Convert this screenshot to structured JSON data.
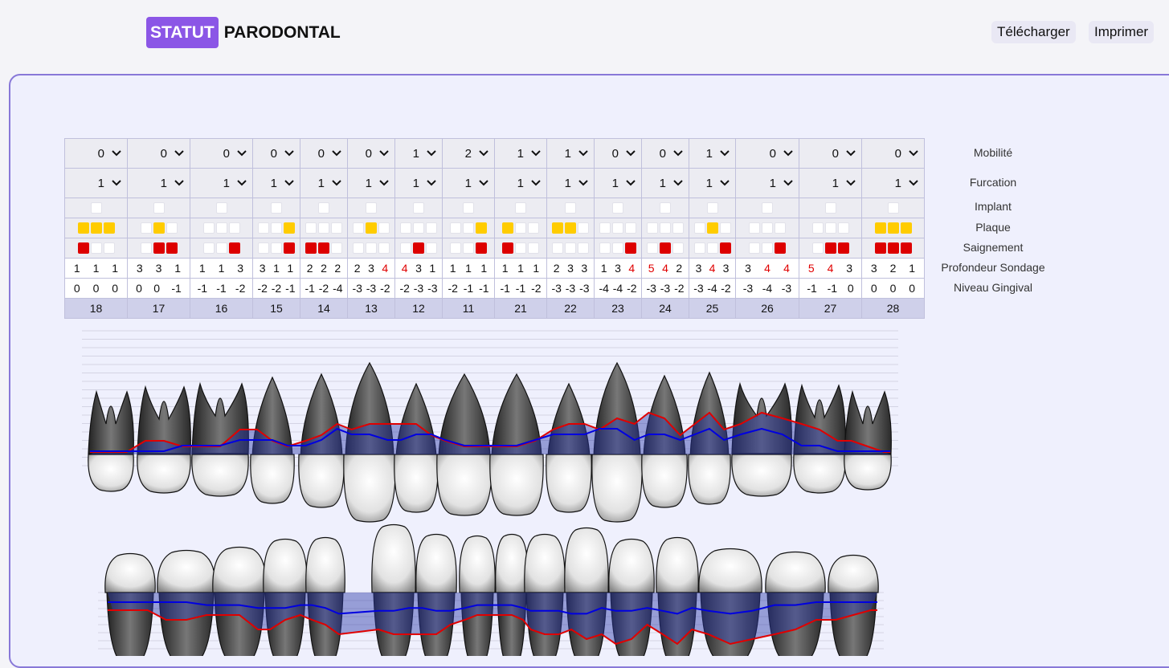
{
  "header": {
    "logo_badge": "STATUT",
    "logo_text": "PARODONTAL",
    "download_label": "Télécharger",
    "print_label": "Imprimer"
  },
  "row_labels": {
    "mobilite": "Mobilité",
    "furcation": "Furcation",
    "implant": "Implant",
    "plaque": "Plaque",
    "saignement": "Saignement",
    "profondeur": "Profondeur Sondage",
    "niveau": "Niveau Gingival"
  },
  "colors": {
    "accent": "#8b56e6",
    "plaque": "#ffcc00",
    "bleeding": "#dd0000",
    "depth_line": "#e00000",
    "gingival_line": "#0000e0"
  },
  "teeth": [
    {
      "id": "18",
      "mobilite": "0",
      "furcation": "1",
      "plaque": [
        1,
        1,
        1
      ],
      "bleeding": [
        1,
        0,
        0
      ],
      "depth": [
        "1",
        "1",
        "1"
      ],
      "depth_red": [
        0,
        0,
        0
      ],
      "gingival": [
        "0",
        "0",
        "0"
      ]
    },
    {
      "id": "17",
      "mobilite": "0",
      "furcation": "1",
      "plaque": [
        0,
        1,
        0
      ],
      "bleeding": [
        0,
        1,
        1
      ],
      "depth": [
        "3",
        "3",
        "1"
      ],
      "depth_red": [
        0,
        0,
        0
      ],
      "gingival": [
        "0",
        "0",
        "-1"
      ]
    },
    {
      "id": "16",
      "mobilite": "0",
      "furcation": "1",
      "plaque": [
        0,
        0,
        0
      ],
      "bleeding": [
        0,
        0,
        1
      ],
      "depth": [
        "1",
        "1",
        "3"
      ],
      "depth_red": [
        0,
        0,
        0
      ],
      "gingival": [
        "-1",
        "-1",
        "-2"
      ]
    },
    {
      "id": "15",
      "mobilite": "0",
      "furcation": "1",
      "plaque": [
        0,
        0,
        1
      ],
      "bleeding": [
        0,
        0,
        1
      ],
      "depth": [
        "3",
        "1",
        "1"
      ],
      "depth_red": [
        0,
        0,
        0
      ],
      "gingival": [
        "-2",
        "-2",
        "-1"
      ]
    },
    {
      "id": "14",
      "mobilite": "0",
      "furcation": "1",
      "plaque": [
        0,
        0,
        0
      ],
      "bleeding": [
        1,
        1,
        0
      ],
      "depth": [
        "2",
        "2",
        "2"
      ],
      "depth_red": [
        0,
        0,
        0
      ],
      "gingival": [
        "-1",
        "-2",
        "-4"
      ]
    },
    {
      "id": "13",
      "mobilite": "0",
      "furcation": "1",
      "plaque": [
        0,
        1,
        0
      ],
      "bleeding": [
        0,
        0,
        0
      ],
      "depth": [
        "2",
        "3",
        "4"
      ],
      "depth_red": [
        0,
        0,
        1
      ],
      "gingival": [
        "-3",
        "-3",
        "-2"
      ]
    },
    {
      "id": "12",
      "mobilite": "1",
      "furcation": "1",
      "plaque": [
        0,
        0,
        0
      ],
      "bleeding": [
        0,
        1,
        0
      ],
      "depth": [
        "4",
        "3",
        "1"
      ],
      "depth_red": [
        1,
        0,
        0
      ],
      "gingival": [
        "-2",
        "-3",
        "-3"
      ]
    },
    {
      "id": "11",
      "mobilite": "2",
      "furcation": "1",
      "plaque": [
        0,
        0,
        1
      ],
      "bleeding": [
        0,
        0,
        1
      ],
      "depth": [
        "1",
        "1",
        "1"
      ],
      "depth_red": [
        0,
        0,
        0
      ],
      "gingival": [
        "-2",
        "-1",
        "-1"
      ]
    },
    {
      "id": "21",
      "mobilite": "1",
      "furcation": "1",
      "plaque": [
        1,
        0,
        0
      ],
      "bleeding": [
        1,
        0,
        0
      ],
      "depth": [
        "1",
        "1",
        "1"
      ],
      "depth_red": [
        0,
        0,
        0
      ],
      "gingival": [
        "-1",
        "-1",
        "-2"
      ]
    },
    {
      "id": "22",
      "mobilite": "1",
      "furcation": "1",
      "plaque": [
        1,
        1,
        0
      ],
      "bleeding": [
        0,
        0,
        0
      ],
      "depth": [
        "2",
        "3",
        "3"
      ],
      "depth_red": [
        0,
        0,
        0
      ],
      "gingival": [
        "-3",
        "-3",
        "-3"
      ]
    },
    {
      "id": "23",
      "mobilite": "0",
      "furcation": "1",
      "plaque": [
        0,
        0,
        0
      ],
      "bleeding": [
        0,
        0,
        1
      ],
      "depth": [
        "1",
        "3",
        "4"
      ],
      "depth_red": [
        0,
        0,
        1
      ],
      "gingival": [
        "-4",
        "-4",
        "-2"
      ]
    },
    {
      "id": "24",
      "mobilite": "0",
      "furcation": "1",
      "plaque": [
        0,
        0,
        0
      ],
      "bleeding": [
        0,
        1,
        0
      ],
      "depth": [
        "5",
        "4",
        "2"
      ],
      "depth_red": [
        1,
        1,
        0
      ],
      "gingival": [
        "-3",
        "-3",
        "-2"
      ]
    },
    {
      "id": "25",
      "mobilite": "1",
      "furcation": "1",
      "plaque": [
        0,
        1,
        0
      ],
      "bleeding": [
        0,
        0,
        1
      ],
      "depth": [
        "3",
        "4",
        "3"
      ],
      "depth_red": [
        0,
        1,
        0
      ],
      "gingival": [
        "-3",
        "-4",
        "-2"
      ]
    },
    {
      "id": "26",
      "mobilite": "0",
      "furcation": "1",
      "plaque": [
        0,
        0,
        0
      ],
      "bleeding": [
        0,
        0,
        1
      ],
      "depth": [
        "3",
        "4",
        "4"
      ],
      "depth_red": [
        0,
        1,
        1
      ],
      "gingival": [
        "-3",
        "-4",
        "-3"
      ]
    },
    {
      "id": "27",
      "mobilite": "0",
      "furcation": "1",
      "plaque": [
        0,
        0,
        0
      ],
      "bleeding": [
        0,
        1,
        1
      ],
      "depth": [
        "5",
        "4",
        "3"
      ],
      "depth_red": [
        1,
        1,
        0
      ],
      "gingival": [
        "-1",
        "-1",
        "0"
      ]
    },
    {
      "id": "28",
      "mobilite": "0",
      "furcation": "1",
      "plaque": [
        1,
        1,
        1
      ],
      "bleeding": [
        1,
        1,
        1
      ],
      "depth": [
        "3",
        "2",
        "1"
      ],
      "depth_red": [
        0,
        0,
        0
      ],
      "gingival": [
        "0",
        "0",
        "0"
      ]
    }
  ]
}
